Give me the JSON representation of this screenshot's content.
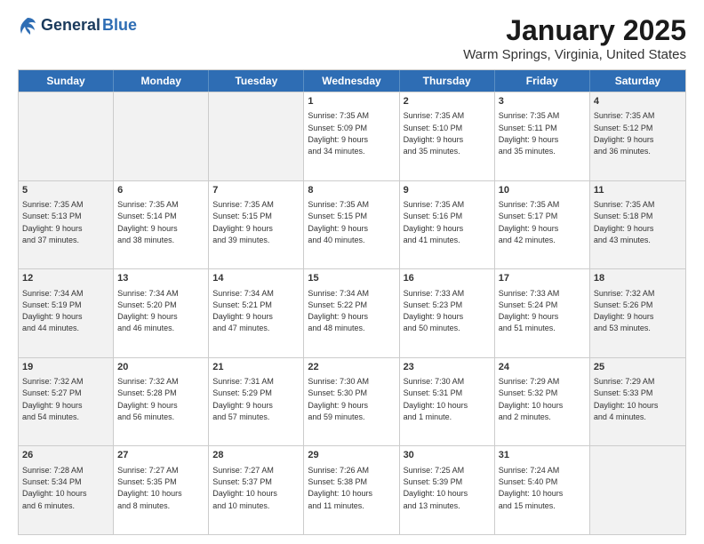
{
  "header": {
    "logo_general": "General",
    "logo_blue": "Blue",
    "title": "January 2025",
    "location": "Warm Springs, Virginia, United States"
  },
  "weekdays": [
    "Sunday",
    "Monday",
    "Tuesday",
    "Wednesday",
    "Thursday",
    "Friday",
    "Saturday"
  ],
  "weeks": [
    [
      {
        "day": "",
        "info": "",
        "shaded": true
      },
      {
        "day": "",
        "info": "",
        "shaded": true
      },
      {
        "day": "",
        "info": "",
        "shaded": true
      },
      {
        "day": "1",
        "info": "Sunrise: 7:35 AM\nSunset: 5:09 PM\nDaylight: 9 hours\nand 34 minutes.",
        "shaded": false
      },
      {
        "day": "2",
        "info": "Sunrise: 7:35 AM\nSunset: 5:10 PM\nDaylight: 9 hours\nand 35 minutes.",
        "shaded": false
      },
      {
        "day": "3",
        "info": "Sunrise: 7:35 AM\nSunset: 5:11 PM\nDaylight: 9 hours\nand 35 minutes.",
        "shaded": false
      },
      {
        "day": "4",
        "info": "Sunrise: 7:35 AM\nSunset: 5:12 PM\nDaylight: 9 hours\nand 36 minutes.",
        "shaded": true
      }
    ],
    [
      {
        "day": "5",
        "info": "Sunrise: 7:35 AM\nSunset: 5:13 PM\nDaylight: 9 hours\nand 37 minutes.",
        "shaded": true
      },
      {
        "day": "6",
        "info": "Sunrise: 7:35 AM\nSunset: 5:14 PM\nDaylight: 9 hours\nand 38 minutes.",
        "shaded": false
      },
      {
        "day": "7",
        "info": "Sunrise: 7:35 AM\nSunset: 5:15 PM\nDaylight: 9 hours\nand 39 minutes.",
        "shaded": false
      },
      {
        "day": "8",
        "info": "Sunrise: 7:35 AM\nSunset: 5:15 PM\nDaylight: 9 hours\nand 40 minutes.",
        "shaded": false
      },
      {
        "day": "9",
        "info": "Sunrise: 7:35 AM\nSunset: 5:16 PM\nDaylight: 9 hours\nand 41 minutes.",
        "shaded": false
      },
      {
        "day": "10",
        "info": "Sunrise: 7:35 AM\nSunset: 5:17 PM\nDaylight: 9 hours\nand 42 minutes.",
        "shaded": false
      },
      {
        "day": "11",
        "info": "Sunrise: 7:35 AM\nSunset: 5:18 PM\nDaylight: 9 hours\nand 43 minutes.",
        "shaded": true
      }
    ],
    [
      {
        "day": "12",
        "info": "Sunrise: 7:34 AM\nSunset: 5:19 PM\nDaylight: 9 hours\nand 44 minutes.",
        "shaded": true
      },
      {
        "day": "13",
        "info": "Sunrise: 7:34 AM\nSunset: 5:20 PM\nDaylight: 9 hours\nand 46 minutes.",
        "shaded": false
      },
      {
        "day": "14",
        "info": "Sunrise: 7:34 AM\nSunset: 5:21 PM\nDaylight: 9 hours\nand 47 minutes.",
        "shaded": false
      },
      {
        "day": "15",
        "info": "Sunrise: 7:34 AM\nSunset: 5:22 PM\nDaylight: 9 hours\nand 48 minutes.",
        "shaded": false
      },
      {
        "day": "16",
        "info": "Sunrise: 7:33 AM\nSunset: 5:23 PM\nDaylight: 9 hours\nand 50 minutes.",
        "shaded": false
      },
      {
        "day": "17",
        "info": "Sunrise: 7:33 AM\nSunset: 5:24 PM\nDaylight: 9 hours\nand 51 minutes.",
        "shaded": false
      },
      {
        "day": "18",
        "info": "Sunrise: 7:32 AM\nSunset: 5:26 PM\nDaylight: 9 hours\nand 53 minutes.",
        "shaded": true
      }
    ],
    [
      {
        "day": "19",
        "info": "Sunrise: 7:32 AM\nSunset: 5:27 PM\nDaylight: 9 hours\nand 54 minutes.",
        "shaded": true
      },
      {
        "day": "20",
        "info": "Sunrise: 7:32 AM\nSunset: 5:28 PM\nDaylight: 9 hours\nand 56 minutes.",
        "shaded": false
      },
      {
        "day": "21",
        "info": "Sunrise: 7:31 AM\nSunset: 5:29 PM\nDaylight: 9 hours\nand 57 minutes.",
        "shaded": false
      },
      {
        "day": "22",
        "info": "Sunrise: 7:30 AM\nSunset: 5:30 PM\nDaylight: 9 hours\nand 59 minutes.",
        "shaded": false
      },
      {
        "day": "23",
        "info": "Sunrise: 7:30 AM\nSunset: 5:31 PM\nDaylight: 10 hours\nand 1 minute.",
        "shaded": false
      },
      {
        "day": "24",
        "info": "Sunrise: 7:29 AM\nSunset: 5:32 PM\nDaylight: 10 hours\nand 2 minutes.",
        "shaded": false
      },
      {
        "day": "25",
        "info": "Sunrise: 7:29 AM\nSunset: 5:33 PM\nDaylight: 10 hours\nand 4 minutes.",
        "shaded": true
      }
    ],
    [
      {
        "day": "26",
        "info": "Sunrise: 7:28 AM\nSunset: 5:34 PM\nDaylight: 10 hours\nand 6 minutes.",
        "shaded": true
      },
      {
        "day": "27",
        "info": "Sunrise: 7:27 AM\nSunset: 5:35 PM\nDaylight: 10 hours\nand 8 minutes.",
        "shaded": false
      },
      {
        "day": "28",
        "info": "Sunrise: 7:27 AM\nSunset: 5:37 PM\nDaylight: 10 hours\nand 10 minutes.",
        "shaded": false
      },
      {
        "day": "29",
        "info": "Sunrise: 7:26 AM\nSunset: 5:38 PM\nDaylight: 10 hours\nand 11 minutes.",
        "shaded": false
      },
      {
        "day": "30",
        "info": "Sunrise: 7:25 AM\nSunset: 5:39 PM\nDaylight: 10 hours\nand 13 minutes.",
        "shaded": false
      },
      {
        "day": "31",
        "info": "Sunrise: 7:24 AM\nSunset: 5:40 PM\nDaylight: 10 hours\nand 15 minutes.",
        "shaded": false
      },
      {
        "day": "",
        "info": "",
        "shaded": true
      }
    ]
  ]
}
